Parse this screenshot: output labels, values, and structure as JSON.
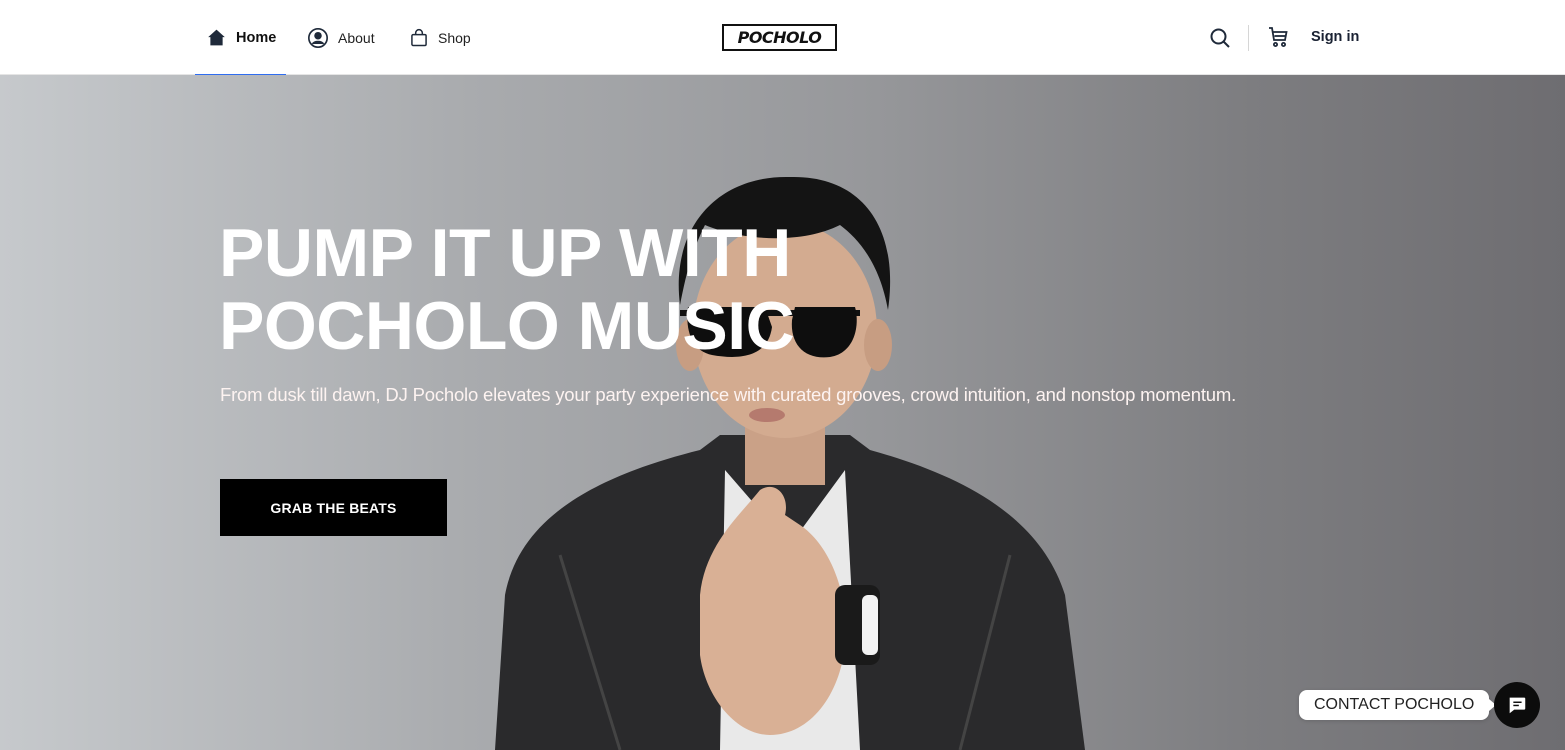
{
  "header": {
    "nav": [
      {
        "label": "Home",
        "icon": "home-icon",
        "active": true
      },
      {
        "label": "About",
        "icon": "user-circle-icon",
        "active": false
      },
      {
        "label": "Shop",
        "icon": "shopping-bag-icon",
        "active": false
      }
    ],
    "logo_text": "POCHOLO",
    "search_icon": "search-icon",
    "cart_icon": "cart-icon",
    "signin_label": "Sign in"
  },
  "hero": {
    "headline_line1": "PUMP IT UP WITH",
    "headline_line2": "POCHOLO MUSIC",
    "subtext": "From dusk till dawn, DJ Pocholo elevates your party experience with curated grooves, crowd intuition, and nonstop momentum.",
    "cta_label": "GRAB THE BEATS"
  },
  "contact": {
    "label": "CONTACT POCHOLO",
    "icon": "chat-icon"
  },
  "colors": {
    "accent": "#2f6df0",
    "cta_bg": "#000000",
    "text_dark": "#1a2233"
  }
}
